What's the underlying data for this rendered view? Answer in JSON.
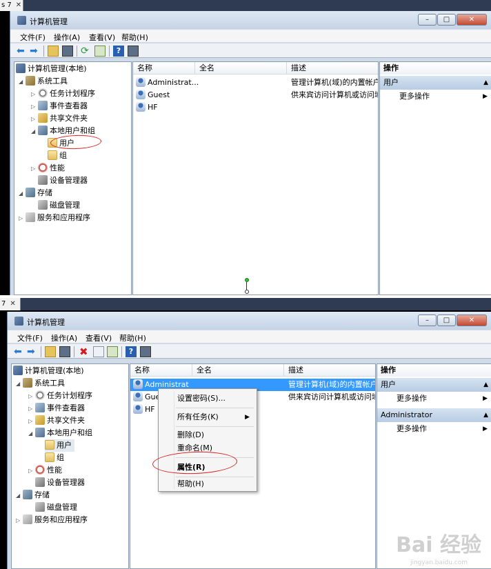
{
  "top": {
    "tab_label": "s 7",
    "tab_close": "✕",
    "title": "计算机管理",
    "menu": [
      "文件(F)",
      "操作(A)",
      "查看(V)",
      "帮助(H)"
    ],
    "tree": [
      {
        "label": "计算机管理(本地)",
        "icon": "computer-management-icon"
      },
      {
        "label": "系统工具",
        "icon": "tools-icon"
      },
      {
        "label": "任务计划程序",
        "icon": "clock-icon"
      },
      {
        "label": "事件查看器",
        "icon": "event-viewer-icon"
      },
      {
        "label": "共享文件夹",
        "icon": "shared-folder-icon"
      },
      {
        "label": "本地用户和组",
        "icon": "users-icon"
      },
      {
        "label": "用户",
        "icon": "folder-icon"
      },
      {
        "label": "组",
        "icon": "folder-icon"
      },
      {
        "label": "性能",
        "icon": "performance-icon"
      },
      {
        "label": "设备管理器",
        "icon": "device-manager-icon"
      },
      {
        "label": "存储",
        "icon": "storage-icon"
      },
      {
        "label": "磁盘管理",
        "icon": "disk-icon"
      },
      {
        "label": "服务和应用程序",
        "icon": "services-icon"
      }
    ],
    "columns": [
      "名称",
      "全名",
      "描述"
    ],
    "rows": [
      {
        "name": "Administrat...",
        "full": "",
        "desc": "管理计算机(域)的内置帐户"
      },
      {
        "name": "Guest",
        "full": "",
        "desc": "供来宾访问计算机或访问域"
      },
      {
        "name": "HF",
        "full": "",
        "desc": ""
      }
    ],
    "actions": {
      "header": "操作",
      "section": "用户",
      "item": "更多操作"
    }
  },
  "bottom": {
    "tab_label": "7",
    "tab_close": "✕",
    "title": "计算机管理",
    "menu": [
      "文件(F)",
      "操作(A)",
      "查看(V)",
      "帮助(H)"
    ],
    "tree": [
      {
        "label": "计算机管理(本地)"
      },
      {
        "label": "系统工具"
      },
      {
        "label": "任务计划程序"
      },
      {
        "label": "事件查看器"
      },
      {
        "label": "共享文件夹"
      },
      {
        "label": "本地用户和组"
      },
      {
        "label": "用户"
      },
      {
        "label": "组"
      },
      {
        "label": "性能"
      },
      {
        "label": "设备管理器"
      },
      {
        "label": "存储"
      },
      {
        "label": "磁盘管理"
      },
      {
        "label": "服务和应用程序"
      }
    ],
    "columns": [
      "名称",
      "全名",
      "描述"
    ],
    "rows": [
      {
        "name": "Administrat",
        "desc": "管理计算机(域)的内置帐户"
      },
      {
        "name": "Gue",
        "desc": "供来宾访问计算机或访问域"
      },
      {
        "name": "HF",
        "desc": ""
      }
    ],
    "context_menu": [
      "设置密码(S)...",
      "所有任务(K)",
      "删除(D)",
      "重命名(M)",
      "属性(R)",
      "帮助(H)"
    ],
    "actions": {
      "header": "操作",
      "section1": "用户",
      "item1": "更多操作",
      "section2": "Administrator",
      "item2": "更多操作"
    }
  },
  "watermark": {
    "text": "Bai 经验",
    "sub": "jingyan.baidu.com"
  },
  "colors": {
    "selection": "#3399ff",
    "annotation": "#dd2222",
    "titlebar": "#cfdbe9"
  }
}
